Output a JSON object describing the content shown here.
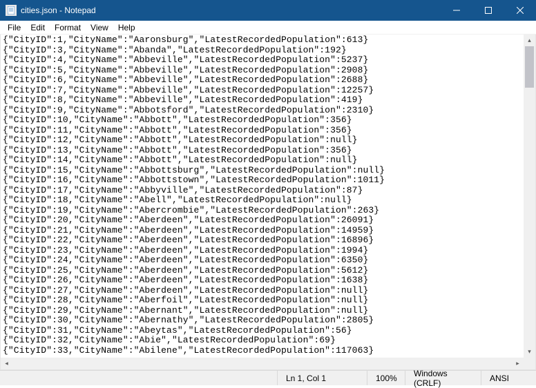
{
  "window": {
    "title": "cities.json - Notepad"
  },
  "menu": {
    "items": [
      "File",
      "Edit",
      "Format",
      "View",
      "Help"
    ]
  },
  "content_lines": [
    "{\"CityID\":1,\"CityName\":\"Aaronsburg\",\"LatestRecordedPopulation\":613}",
    "{\"CityID\":3,\"CityName\":\"Abanda\",\"LatestRecordedPopulation\":192}",
    "{\"CityID\":4,\"CityName\":\"Abbeville\",\"LatestRecordedPopulation\":5237}",
    "{\"CityID\":5,\"CityName\":\"Abbeville\",\"LatestRecordedPopulation\":2908}",
    "{\"CityID\":6,\"CityName\":\"Abbeville\",\"LatestRecordedPopulation\":2688}",
    "{\"CityID\":7,\"CityName\":\"Abbeville\",\"LatestRecordedPopulation\":12257}",
    "{\"CityID\":8,\"CityName\":\"Abbeville\",\"LatestRecordedPopulation\":419}",
    "{\"CityID\":9,\"CityName\":\"Abbotsford\",\"LatestRecordedPopulation\":2310}",
    "{\"CityID\":10,\"CityName\":\"Abbott\",\"LatestRecordedPopulation\":356}",
    "{\"CityID\":11,\"CityName\":\"Abbott\",\"LatestRecordedPopulation\":356}",
    "{\"CityID\":12,\"CityName\":\"Abbott\",\"LatestRecordedPopulation\":null}",
    "{\"CityID\":13,\"CityName\":\"Abbott\",\"LatestRecordedPopulation\":356}",
    "{\"CityID\":14,\"CityName\":\"Abbott\",\"LatestRecordedPopulation\":null}",
    "{\"CityID\":15,\"CityName\":\"Abbottsburg\",\"LatestRecordedPopulation\":null}",
    "{\"CityID\":16,\"CityName\":\"Abbottstown\",\"LatestRecordedPopulation\":1011}",
    "{\"CityID\":17,\"CityName\":\"Abbyville\",\"LatestRecordedPopulation\":87}",
    "{\"CityID\":18,\"CityName\":\"Abell\",\"LatestRecordedPopulation\":null}",
    "{\"CityID\":19,\"CityName\":\"Abercrombie\",\"LatestRecordedPopulation\":263}",
    "{\"CityID\":20,\"CityName\":\"Aberdeen\",\"LatestRecordedPopulation\":26091}",
    "{\"CityID\":21,\"CityName\":\"Aberdeen\",\"LatestRecordedPopulation\":14959}",
    "{\"CityID\":22,\"CityName\":\"Aberdeen\",\"LatestRecordedPopulation\":16896}",
    "{\"CityID\":23,\"CityName\":\"Aberdeen\",\"LatestRecordedPopulation\":1994}",
    "{\"CityID\":24,\"CityName\":\"Aberdeen\",\"LatestRecordedPopulation\":6350}",
    "{\"CityID\":25,\"CityName\":\"Aberdeen\",\"LatestRecordedPopulation\":5612}",
    "{\"CityID\":26,\"CityName\":\"Aberdeen\",\"LatestRecordedPopulation\":1638}",
    "{\"CityID\":27,\"CityName\":\"Aberdeen\",\"LatestRecordedPopulation\":null}",
    "{\"CityID\":28,\"CityName\":\"Aberfoil\",\"LatestRecordedPopulation\":null}",
    "{\"CityID\":29,\"CityName\":\"Abernant\",\"LatestRecordedPopulation\":null}",
    "{\"CityID\":30,\"CityName\":\"Abernathy\",\"LatestRecordedPopulation\":2805}",
    "{\"CityID\":31,\"CityName\":\"Abeytas\",\"LatestRecordedPopulation\":56}",
    "{\"CityID\":32,\"CityName\":\"Abie\",\"LatestRecordedPopulation\":69}",
    "{\"CityID\":33,\"CityName\":\"Abilene\",\"LatestRecordedPopulation\":117063}"
  ],
  "status": {
    "position": "Ln 1, Col 1",
    "zoom": "100%",
    "line_ending": "Windows (CRLF)",
    "encoding": "ANSI"
  }
}
